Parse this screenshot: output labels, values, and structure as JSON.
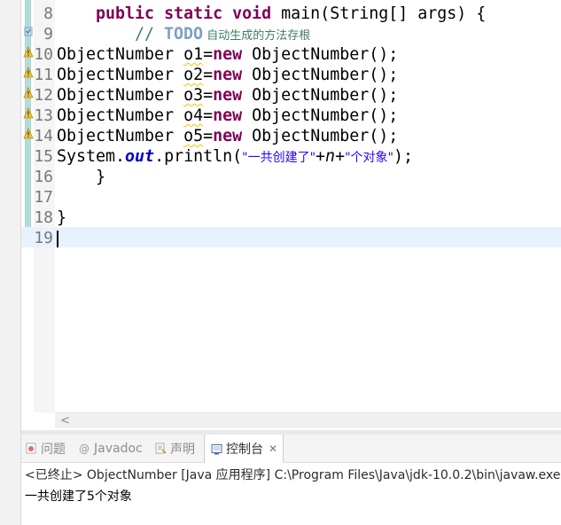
{
  "editor": {
    "lines": [
      {
        "n": "8"
      },
      {
        "n": "9"
      },
      {
        "n": "10"
      },
      {
        "n": "11"
      },
      {
        "n": "12"
      },
      {
        "n": "13"
      },
      {
        "n": "14"
      },
      {
        "n": "15"
      },
      {
        "n": "16"
      },
      {
        "n": "17"
      },
      {
        "n": "18"
      },
      {
        "n": "19"
      }
    ],
    "code": {
      "l8_public": "public",
      "l8_static": "static",
      "l8_void": "void",
      "l8_rest": " main(String[] args) {",
      "l9_slashes": "// ",
      "l9_todo": "TODO",
      "l9_text": " 自动生成的方法存根",
      "obj_type": "ObjectNumber ",
      "obj_new": "new",
      "obj_ctor": " ObjectNumber();",
      "vars": [
        "o1",
        "o2",
        "o3",
        "o4",
        "o5"
      ],
      "eq": "=",
      "l15_system": "System.",
      "l15_out": "out",
      "l15_println": ".println(",
      "l15_str1": "\"一共创建了\"",
      "l15_plus1": "+",
      "l15_n": "n",
      "l15_plus2": "+",
      "l15_str2": "\"个对象\"",
      "l15_end": ");",
      "l16": "}",
      "l18": "}"
    },
    "scroll_left_glyph": "<"
  },
  "panel": {
    "tabs": [
      {
        "label": "问题",
        "icon": "problems-icon",
        "active": false
      },
      {
        "label": "Javadoc",
        "icon": "javadoc-icon",
        "active": false
      },
      {
        "label": "声明",
        "icon": "declaration-icon",
        "active": false
      },
      {
        "label": "控制台",
        "icon": "console-icon",
        "active": true,
        "close": "✕"
      }
    ],
    "console_header": "<已终止> ObjectNumber [Java 应用程序] C:\\Program Files\\Java\\jdk-10.0.2\\bin\\javaw.exe",
    "console_output": "一共创建了5个对象"
  },
  "colors": {
    "keyword": "#7f0055",
    "comment": "#3f7f5f",
    "string": "#2a00ff",
    "field": "#0000c0",
    "current_line": "#e8f2fe"
  }
}
